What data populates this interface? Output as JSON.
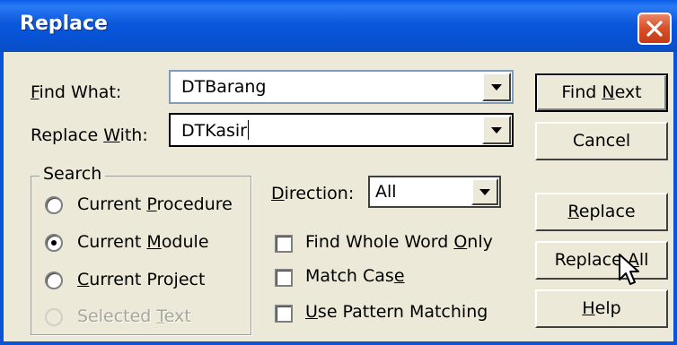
{
  "window": {
    "title": "Replace"
  },
  "find": {
    "label": "Find What:",
    "value": "DTBarang"
  },
  "replace": {
    "label": "Replace With:",
    "value": "DTKasir"
  },
  "buttons": {
    "find_next": "Find Next",
    "cancel": "Cancel",
    "replace": "Replace",
    "replace_all": "Replace All",
    "help": "Help"
  },
  "search": {
    "group_label": "Search",
    "options": [
      {
        "label": "Current Procedure",
        "selected": false,
        "enabled": true
      },
      {
        "label": "Current Module",
        "selected": true,
        "enabled": true
      },
      {
        "label": "Current Project",
        "selected": false,
        "enabled": true
      },
      {
        "label": "Selected Text",
        "selected": false,
        "enabled": false
      }
    ]
  },
  "direction": {
    "label": "Direction:",
    "value": "All"
  },
  "checkboxes": [
    {
      "label": "Find Whole Word Only",
      "checked": false
    },
    {
      "label": "Match Case",
      "checked": false
    },
    {
      "label": "Use Pattern Matching",
      "checked": false
    }
  ],
  "colors": {
    "titlebar": "#0a54d6",
    "close_button": "#d9532d",
    "dialog_bg": "#ece9d8"
  },
  "icons": {
    "close": "close-icon",
    "dropdown": "chevron-down-icon",
    "cursor": "mouse-pointer-icon"
  }
}
